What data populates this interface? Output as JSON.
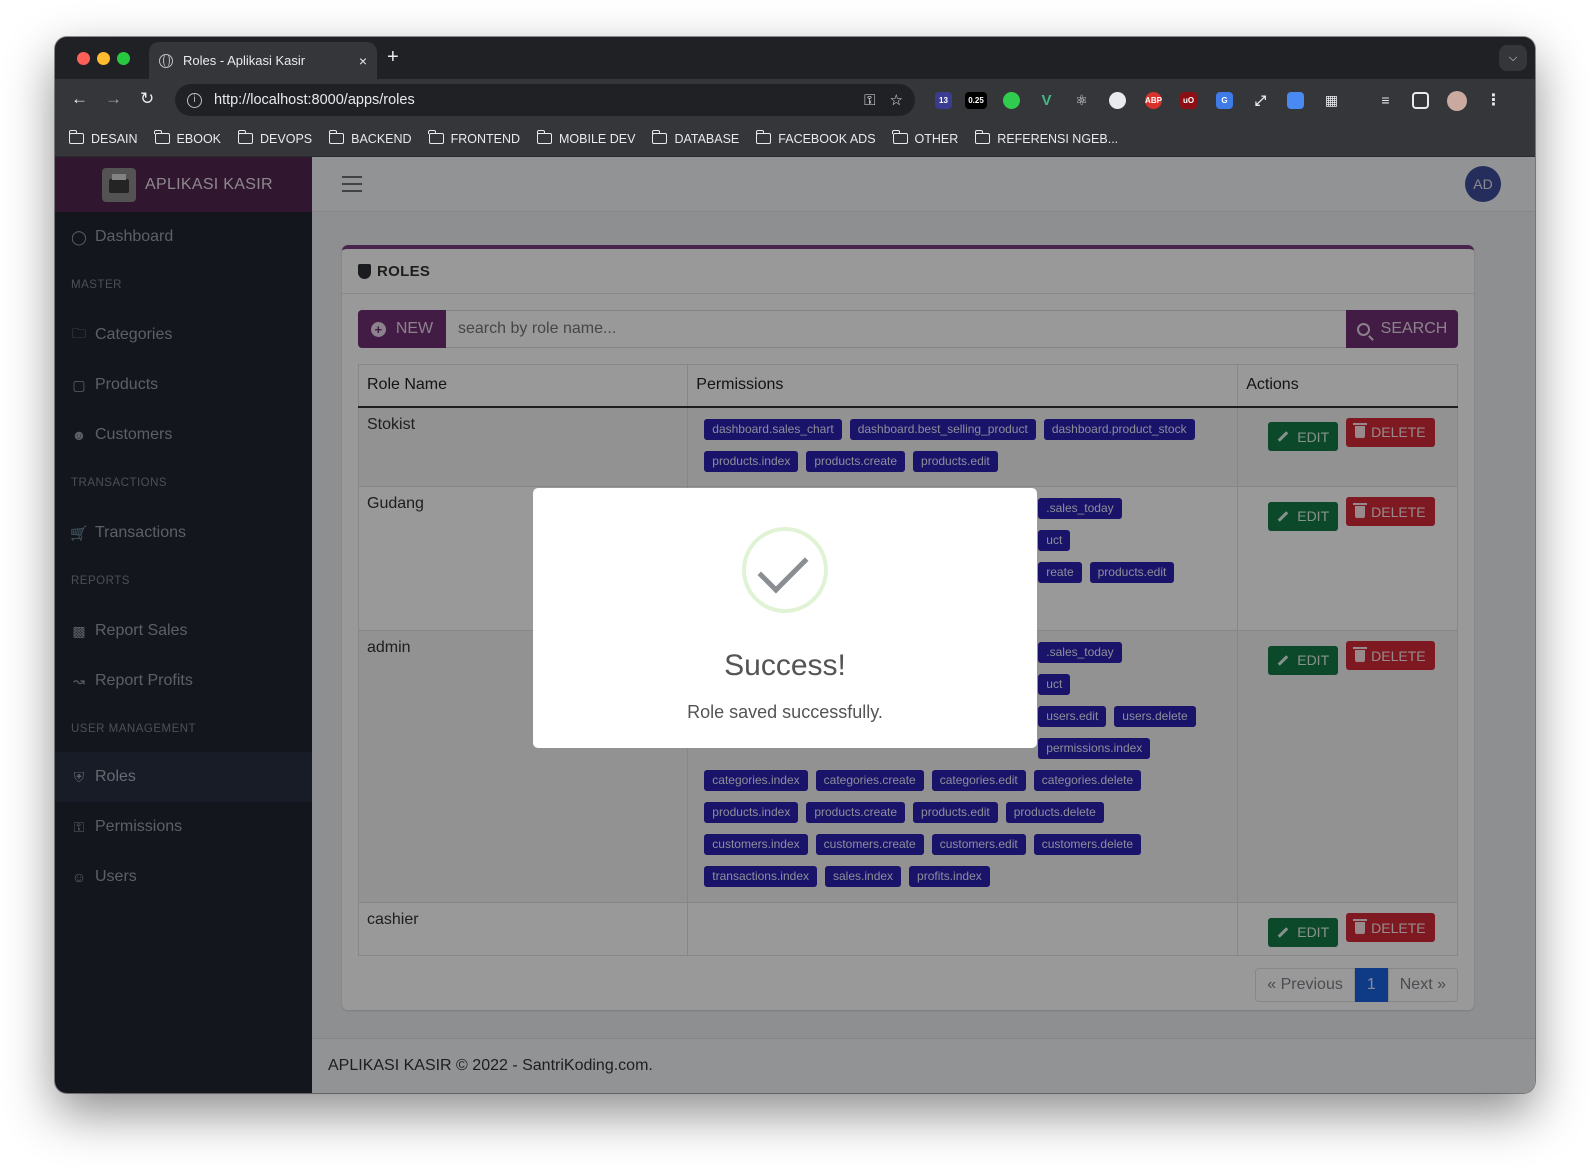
{
  "browser": {
    "tab_title": "Roles - Aplikasi Kasir",
    "tab_close": "×",
    "new_tab": "+",
    "url": "http://localhost:8000/apps/roles",
    "ext_badges": {
      "a": "13",
      "b": "0.25"
    },
    "bookmarks": [
      "DESAIN",
      "EBOOK",
      "DEVOPS",
      "BACKEND",
      "FRONTEND",
      "MOBILE DEV",
      "DATABASE",
      "FACEBOOK ADS",
      "OTHER",
      "REFERENSI NGEB..."
    ]
  },
  "app": {
    "brand": "APLIKASI KASIR",
    "avatar": "AD"
  },
  "sidebar": {
    "dashboard": "Dashboard",
    "sec_master": "MASTER",
    "categories": "Categories",
    "products": "Products",
    "customers": "Customers",
    "sec_transactions": "TRANSACTIONS",
    "transactions": "Transactions",
    "sec_reports": "REPORTS",
    "report_sales": "Report Sales",
    "report_profits": "Report Profits",
    "sec_user_mgmt": "USER MANAGEMENT",
    "roles": "Roles",
    "permissions": "Permissions",
    "users": "Users"
  },
  "card": {
    "title": "ROLES",
    "new_label": "NEW",
    "search_placeholder": "search by role name...",
    "search_label": "SEARCH"
  },
  "table": {
    "headers": {
      "name": "Role Name",
      "permissions": "Permissions",
      "actions": "Actions"
    },
    "edit_label": "EDIT",
    "delete_label": "DELETE",
    "rows": [
      {
        "name": "Stokist",
        "permissions": [
          "dashboard.sales_chart",
          "dashboard.best_selling_product",
          "dashboard.product_stock",
          "products.index",
          "products.create",
          "products.edit"
        ]
      },
      {
        "name": "Gudang",
        "permissions": [
          ".sales_today",
          "uct",
          "reate",
          "products.edit"
        ]
      },
      {
        "name": "admin",
        "permissions": [
          ".sales_today",
          "uct",
          "users.edit",
          "users.delete",
          "permissions.index",
          "categories.index",
          "categories.create",
          "categories.edit",
          "categories.delete",
          "products.index",
          "products.create",
          "products.edit",
          "products.delete",
          "customers.index",
          "customers.create",
          "customers.edit",
          "customers.delete",
          "transactions.index",
          "sales.index",
          "profits.index"
        ]
      },
      {
        "name": "cashier",
        "permissions": []
      }
    ]
  },
  "pagination": {
    "prev": "« Previous",
    "current": "1",
    "next": "Next »"
  },
  "footer": {
    "brand": "APLIKASI KASIR",
    "text": " © 2022 - SantriKoding.com."
  },
  "modal": {
    "title": "Success!",
    "text": "Role saved successfully."
  },
  "colors": {
    "brand": "#53264f",
    "primary_button": "#6e2f73",
    "badge": "#2b20b0",
    "edit": "#137a47",
    "delete": "#d32a38",
    "page_active": "#1a63e0"
  }
}
